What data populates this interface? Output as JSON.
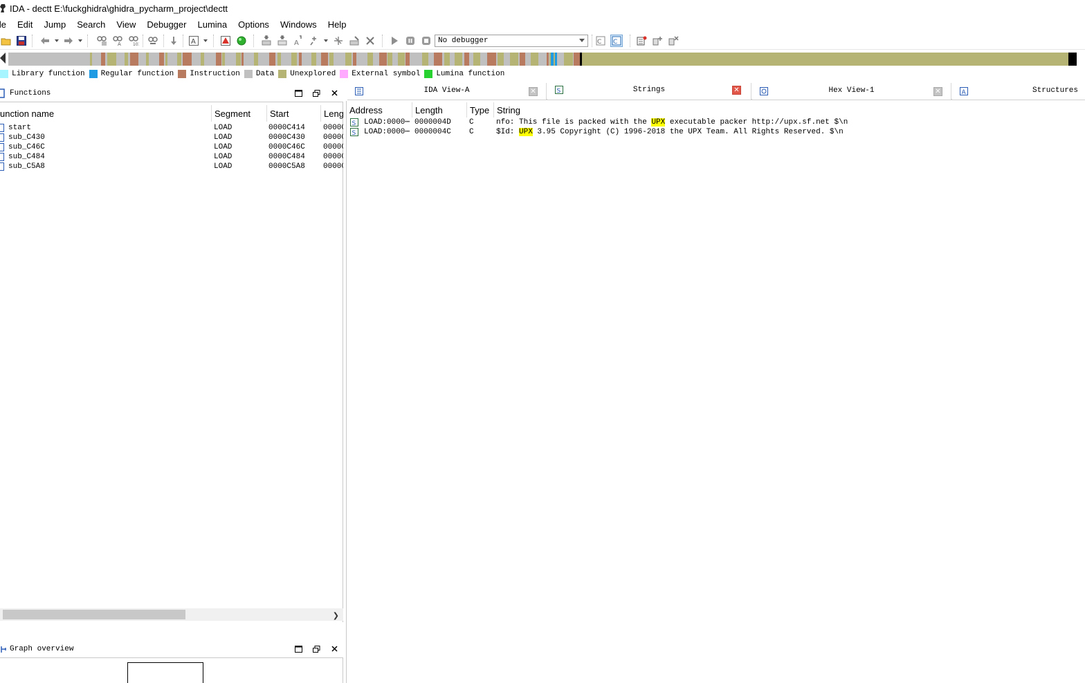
{
  "window": {
    "title": "IDA - dectt E:\\fuckghidra\\ghidra_pycharm_project\\dectt"
  },
  "menu": [
    "ile",
    "Edit",
    "Jump",
    "Search",
    "View",
    "Debugger",
    "Lumina",
    "Options",
    "Windows",
    "Help"
  ],
  "toolbar": {
    "debugger_select": "No debugger"
  },
  "legend": [
    {
      "label": "Library function",
      "color": "#a6f5ff"
    },
    {
      "label": "Regular function",
      "color": "#1e9be3"
    },
    {
      "label": "Instruction",
      "color": "#b87b5f"
    },
    {
      "label": "Data",
      "color": "#c0c0c0"
    },
    {
      "label": "Unexplored",
      "color": "#b5b474"
    },
    {
      "label": "External symbol",
      "color": "#ffaaff"
    },
    {
      "label": "Lumina function",
      "color": "#27d130"
    }
  ],
  "functions_panel": {
    "title": "Functions",
    "columns": [
      "unction name",
      "Segment",
      "Start",
      "Leng"
    ],
    "rows": [
      {
        "name": "start",
        "segment": "LOAD",
        "start": "0000C414",
        "length": "00000"
      },
      {
        "name": "sub_C430",
        "segment": "LOAD",
        "start": "0000C430",
        "length": "00000"
      },
      {
        "name": "sub_C46C",
        "segment": "LOAD",
        "start": "0000C46C",
        "length": "00000"
      },
      {
        "name": "sub_C484",
        "segment": "LOAD",
        "start": "0000C484",
        "length": "00000"
      },
      {
        "name": "sub_C5A8",
        "segment": "LOAD",
        "start": "0000C5A8",
        "length": "00000"
      }
    ]
  },
  "graph_panel": {
    "title": "Graph overview"
  },
  "tabs": [
    {
      "label": "IDA View-A",
      "active": false
    },
    {
      "label": "Strings",
      "active": true
    },
    {
      "label": "Hex View-1",
      "active": false
    },
    {
      "label": "Structures",
      "active": false
    }
  ],
  "strings_view": {
    "columns": [
      "Address",
      "Length",
      "Type",
      "String"
    ],
    "rows": [
      {
        "address": "LOAD:0000⋯",
        "length": "0000004D",
        "type": "C",
        "string_pre": "nfo: This file is packed with the ",
        "string_hl": "UPX",
        "string_post": " executable packer http://upx.sf.net $\\n"
      },
      {
        "address": "LOAD:0000⋯",
        "length": "0000004C",
        "type": "C",
        "string_pre": "$Id: ",
        "string_hl": "UPX",
        "string_post": " 3.95 Copyright (C) 1996-2018 the UPX Team. All Rights Reserved. $\\n"
      }
    ]
  },
  "colors": {
    "instruction": "#b87b5f",
    "unexplored": "#b5b474",
    "data": "#c0c0c0",
    "regular_function": "#1e9be3",
    "highlight": "#ffff00",
    "active_close": "#e1574a"
  }
}
